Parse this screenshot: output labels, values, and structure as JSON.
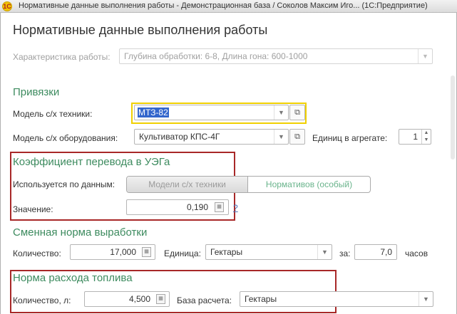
{
  "window": {
    "title": "Нормативные данные выполнения работы - Демонстрационная база / Соколов Максим Иго...   (1С:Предприятие)",
    "icon": "1c-app-icon"
  },
  "form": {
    "title": "Нормативные данные выполнения работы",
    "characteristic": {
      "label": "Характеристика работы:",
      "value": "Глубина обработки: 6-8, Длина гона: 600-1000"
    },
    "bindings": {
      "section_title": "Привязки",
      "machine_model": {
        "label": "Модель с/х техники:",
        "value": "МТЗ-82"
      },
      "equipment_model": {
        "label": "Модель с/х оборудования:",
        "value": "Культиватор КПС-4Г"
      },
      "units_in_aggregate": {
        "label": "Единиц в агрегате:",
        "value": "1"
      }
    },
    "coefficient": {
      "section_title": "Коэффициент перевода в УЭГа",
      "used_by_label": "Используется по данным:",
      "option_models": "Модели с/х техники",
      "option_norms": "Нормативов (особый)",
      "value_label": "Значение:",
      "value": "0,190",
      "help": "?"
    },
    "shift_norm": {
      "section_title": "Сменная норма выработки",
      "quantity_label": "Количество:",
      "quantity": "17,000",
      "unit_label": "Единица:",
      "unit": "Гектары",
      "per_label": "за:",
      "per_value": "7,0",
      "per_unit": "часов"
    },
    "fuel": {
      "section_title": "Норма расхода топлива",
      "quantity_label": "Количество, л:",
      "quantity": "4,500",
      "basis_label": "База расчета:",
      "basis": "Гектары"
    }
  },
  "colors": {
    "section_green": "#3d8b5f",
    "highlight_yellow": "#f0d000",
    "annotation_red": "#a82828",
    "selection_blue": "#3366cc"
  }
}
